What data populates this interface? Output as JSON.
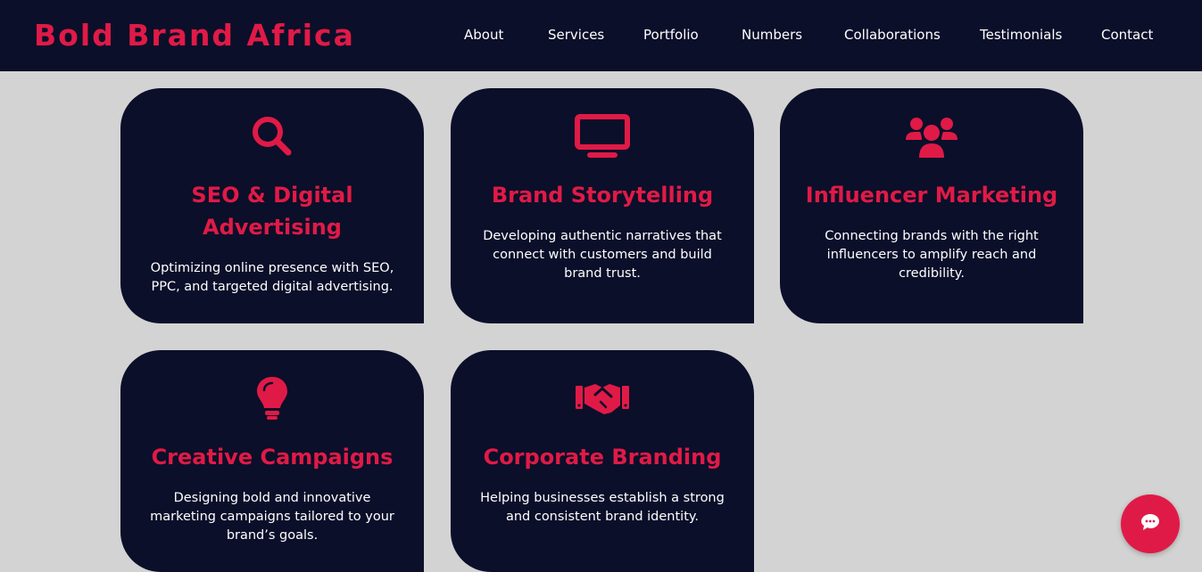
{
  "colors": {
    "accent": "#e01a46",
    "dark": "#0b0f2a",
    "background": "#d3d3d3",
    "text": "#ffffff"
  },
  "header": {
    "brand": "Bold Brand Africa",
    "nav": [
      "About",
      "Services",
      "Portfolio",
      "Numbers",
      "Collaborations",
      "Testimonials",
      "Contact"
    ]
  },
  "services": [
    {
      "icon": "search-icon",
      "title": "SEO & Digital Advertising",
      "description": "Optimizing online presence with SEO, PPC, and targeted digital advertising."
    },
    {
      "icon": "monitor-icon",
      "title": "Brand Storytelling",
      "description": "Developing authentic narratives that connect with customers and build brand trust."
    },
    {
      "icon": "users-icon",
      "title": "Influencer Marketing",
      "description": "Connecting brands with the right influencers to amplify reach and credibility."
    },
    {
      "icon": "lightbulb-icon",
      "title": "Creative Campaigns",
      "description": "Designing bold and innovative marketing campaigns tailored to your brand’s goals."
    },
    {
      "icon": "handshake-icon",
      "title": "Corporate Branding",
      "description": "Helping businesses establish a strong and consistent brand identity."
    }
  ],
  "chat": {
    "icon": "chat-bubble-icon"
  }
}
